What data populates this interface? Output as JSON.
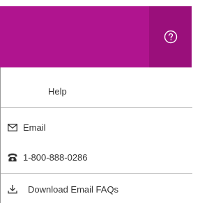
{
  "header": {
    "help_button_icon": "question-circle-icon",
    "accent_color": "#b0148f",
    "accent_dark_color": "#9a0f7b"
  },
  "menu": {
    "title": "Help",
    "items": [
      {
        "label": "Email",
        "icon": "envelope-icon"
      },
      {
        "label": "1-800-888-0286",
        "icon": "telephone-icon"
      },
      {
        "label": "Download Email FAQs",
        "icon": "download-icon"
      }
    ]
  }
}
